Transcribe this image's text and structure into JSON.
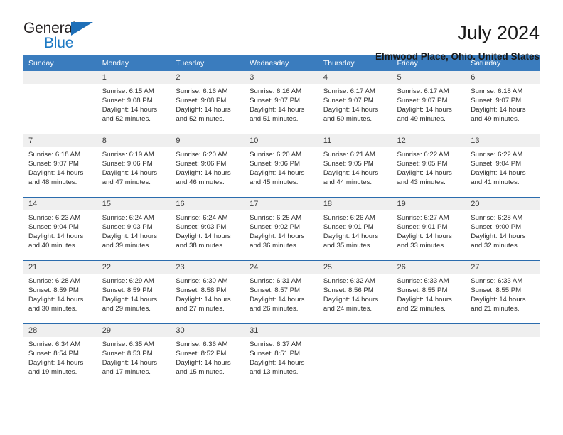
{
  "brand": {
    "name_part1": "General",
    "name_part2": "Blue",
    "accent_color": "#1e7ac4",
    "triangle_color": "#1e6fb8"
  },
  "header": {
    "title": "July 2024",
    "subtitle": "Elmwood Place, Ohio, United States"
  },
  "calendar": {
    "header_bg": "#3a7cbe",
    "daynum_bg": "#efefef",
    "row_divider": "#2b6cad",
    "weekday_headers": [
      "Sunday",
      "Monday",
      "Tuesday",
      "Wednesday",
      "Thursday",
      "Friday",
      "Saturday"
    ],
    "weeks": [
      [
        {
          "day": "",
          "sunrise": "",
          "sunset": "",
          "daylight_line1": "",
          "daylight_line2": ""
        },
        {
          "day": "1",
          "sunrise": "Sunrise: 6:15 AM",
          "sunset": "Sunset: 9:08 PM",
          "daylight_line1": "Daylight: 14 hours",
          "daylight_line2": "and 52 minutes."
        },
        {
          "day": "2",
          "sunrise": "Sunrise: 6:16 AM",
          "sunset": "Sunset: 9:08 PM",
          "daylight_line1": "Daylight: 14 hours",
          "daylight_line2": "and 52 minutes."
        },
        {
          "day": "3",
          "sunrise": "Sunrise: 6:16 AM",
          "sunset": "Sunset: 9:07 PM",
          "daylight_line1": "Daylight: 14 hours",
          "daylight_line2": "and 51 minutes."
        },
        {
          "day": "4",
          "sunrise": "Sunrise: 6:17 AM",
          "sunset": "Sunset: 9:07 PM",
          "daylight_line1": "Daylight: 14 hours",
          "daylight_line2": "and 50 minutes."
        },
        {
          "day": "5",
          "sunrise": "Sunrise: 6:17 AM",
          "sunset": "Sunset: 9:07 PM",
          "daylight_line1": "Daylight: 14 hours",
          "daylight_line2": "and 49 minutes."
        },
        {
          "day": "6",
          "sunrise": "Sunrise: 6:18 AM",
          "sunset": "Sunset: 9:07 PM",
          "daylight_line1": "Daylight: 14 hours",
          "daylight_line2": "and 49 minutes."
        }
      ],
      [
        {
          "day": "7",
          "sunrise": "Sunrise: 6:18 AM",
          "sunset": "Sunset: 9:07 PM",
          "daylight_line1": "Daylight: 14 hours",
          "daylight_line2": "and 48 minutes."
        },
        {
          "day": "8",
          "sunrise": "Sunrise: 6:19 AM",
          "sunset": "Sunset: 9:06 PM",
          "daylight_line1": "Daylight: 14 hours",
          "daylight_line2": "and 47 minutes."
        },
        {
          "day": "9",
          "sunrise": "Sunrise: 6:20 AM",
          "sunset": "Sunset: 9:06 PM",
          "daylight_line1": "Daylight: 14 hours",
          "daylight_line2": "and 46 minutes."
        },
        {
          "day": "10",
          "sunrise": "Sunrise: 6:20 AM",
          "sunset": "Sunset: 9:06 PM",
          "daylight_line1": "Daylight: 14 hours",
          "daylight_line2": "and 45 minutes."
        },
        {
          "day": "11",
          "sunrise": "Sunrise: 6:21 AM",
          "sunset": "Sunset: 9:05 PM",
          "daylight_line1": "Daylight: 14 hours",
          "daylight_line2": "and 44 minutes."
        },
        {
          "day": "12",
          "sunrise": "Sunrise: 6:22 AM",
          "sunset": "Sunset: 9:05 PM",
          "daylight_line1": "Daylight: 14 hours",
          "daylight_line2": "and 43 minutes."
        },
        {
          "day": "13",
          "sunrise": "Sunrise: 6:22 AM",
          "sunset": "Sunset: 9:04 PM",
          "daylight_line1": "Daylight: 14 hours",
          "daylight_line2": "and 41 minutes."
        }
      ],
      [
        {
          "day": "14",
          "sunrise": "Sunrise: 6:23 AM",
          "sunset": "Sunset: 9:04 PM",
          "daylight_line1": "Daylight: 14 hours",
          "daylight_line2": "and 40 minutes."
        },
        {
          "day": "15",
          "sunrise": "Sunrise: 6:24 AM",
          "sunset": "Sunset: 9:03 PM",
          "daylight_line1": "Daylight: 14 hours",
          "daylight_line2": "and 39 minutes."
        },
        {
          "day": "16",
          "sunrise": "Sunrise: 6:24 AM",
          "sunset": "Sunset: 9:03 PM",
          "daylight_line1": "Daylight: 14 hours",
          "daylight_line2": "and 38 minutes."
        },
        {
          "day": "17",
          "sunrise": "Sunrise: 6:25 AM",
          "sunset": "Sunset: 9:02 PM",
          "daylight_line1": "Daylight: 14 hours",
          "daylight_line2": "and 36 minutes."
        },
        {
          "day": "18",
          "sunrise": "Sunrise: 6:26 AM",
          "sunset": "Sunset: 9:01 PM",
          "daylight_line1": "Daylight: 14 hours",
          "daylight_line2": "and 35 minutes."
        },
        {
          "day": "19",
          "sunrise": "Sunrise: 6:27 AM",
          "sunset": "Sunset: 9:01 PM",
          "daylight_line1": "Daylight: 14 hours",
          "daylight_line2": "and 33 minutes."
        },
        {
          "day": "20",
          "sunrise": "Sunrise: 6:28 AM",
          "sunset": "Sunset: 9:00 PM",
          "daylight_line1": "Daylight: 14 hours",
          "daylight_line2": "and 32 minutes."
        }
      ],
      [
        {
          "day": "21",
          "sunrise": "Sunrise: 6:28 AM",
          "sunset": "Sunset: 8:59 PM",
          "daylight_line1": "Daylight: 14 hours",
          "daylight_line2": "and 30 minutes."
        },
        {
          "day": "22",
          "sunrise": "Sunrise: 6:29 AM",
          "sunset": "Sunset: 8:59 PM",
          "daylight_line1": "Daylight: 14 hours",
          "daylight_line2": "and 29 minutes."
        },
        {
          "day": "23",
          "sunrise": "Sunrise: 6:30 AM",
          "sunset": "Sunset: 8:58 PM",
          "daylight_line1": "Daylight: 14 hours",
          "daylight_line2": "and 27 minutes."
        },
        {
          "day": "24",
          "sunrise": "Sunrise: 6:31 AM",
          "sunset": "Sunset: 8:57 PM",
          "daylight_line1": "Daylight: 14 hours",
          "daylight_line2": "and 26 minutes."
        },
        {
          "day": "25",
          "sunrise": "Sunrise: 6:32 AM",
          "sunset": "Sunset: 8:56 PM",
          "daylight_line1": "Daylight: 14 hours",
          "daylight_line2": "and 24 minutes."
        },
        {
          "day": "26",
          "sunrise": "Sunrise: 6:33 AM",
          "sunset": "Sunset: 8:55 PM",
          "daylight_line1": "Daylight: 14 hours",
          "daylight_line2": "and 22 minutes."
        },
        {
          "day": "27",
          "sunrise": "Sunrise: 6:33 AM",
          "sunset": "Sunset: 8:55 PM",
          "daylight_line1": "Daylight: 14 hours",
          "daylight_line2": "and 21 minutes."
        }
      ],
      [
        {
          "day": "28",
          "sunrise": "Sunrise: 6:34 AM",
          "sunset": "Sunset: 8:54 PM",
          "daylight_line1": "Daylight: 14 hours",
          "daylight_line2": "and 19 minutes."
        },
        {
          "day": "29",
          "sunrise": "Sunrise: 6:35 AM",
          "sunset": "Sunset: 8:53 PM",
          "daylight_line1": "Daylight: 14 hours",
          "daylight_line2": "and 17 minutes."
        },
        {
          "day": "30",
          "sunrise": "Sunrise: 6:36 AM",
          "sunset": "Sunset: 8:52 PM",
          "daylight_line1": "Daylight: 14 hours",
          "daylight_line2": "and 15 minutes."
        },
        {
          "day": "31",
          "sunrise": "Sunrise: 6:37 AM",
          "sunset": "Sunset: 8:51 PM",
          "daylight_line1": "Daylight: 14 hours",
          "daylight_line2": "and 13 minutes."
        },
        {
          "day": "",
          "sunrise": "",
          "sunset": "",
          "daylight_line1": "",
          "daylight_line2": ""
        },
        {
          "day": "",
          "sunrise": "",
          "sunset": "",
          "daylight_line1": "",
          "daylight_line2": ""
        },
        {
          "day": "",
          "sunrise": "",
          "sunset": "",
          "daylight_line1": "",
          "daylight_line2": ""
        }
      ]
    ]
  }
}
